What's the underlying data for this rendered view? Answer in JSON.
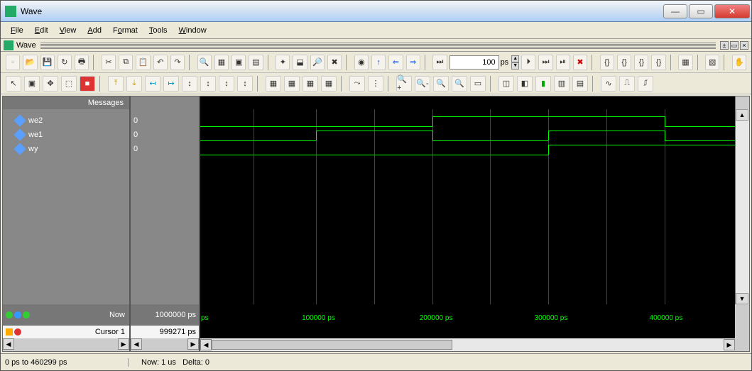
{
  "window": {
    "title": "Wave",
    "panel_title": "Wave"
  },
  "menu": {
    "file": "File",
    "edit": "Edit",
    "view": "View",
    "add": "Add",
    "format": "Format",
    "tools": "Tools",
    "window": "Window"
  },
  "toolbar": {
    "time_value": "100",
    "time_unit": "ps"
  },
  "header": {
    "messages": "Messages"
  },
  "signals": [
    {
      "name": "we2",
      "value": "0"
    },
    {
      "name": "we1",
      "value": "0"
    },
    {
      "name": "wy",
      "value": "0"
    }
  ],
  "chart_data": {
    "type": "timing-diagram",
    "x_unit": "ps",
    "visible_range": [
      0,
      460299
    ],
    "ticks": [
      "ps",
      "100000 ps",
      "200000 ps",
      "300000 ps",
      "400000 ps"
    ],
    "signals": {
      "we2": {
        "initial": 0,
        "edges": [
          {
            "t": 200000,
            "v": 1
          },
          {
            "t": 400000,
            "v": 0
          }
        ]
      },
      "we1": {
        "initial": 0,
        "edges": [
          {
            "t": 100000,
            "v": 1
          },
          {
            "t": 200000,
            "v": 0
          },
          {
            "t": 300000,
            "v": 1
          },
          {
            "t": 400000,
            "v": 0
          }
        ]
      },
      "wy": {
        "initial": 0,
        "edges": [
          {
            "t": 300000,
            "v": 1
          }
        ]
      }
    }
  },
  "time": {
    "now_label": "Now",
    "now_value": "1000000 ps",
    "cursor_label": "Cursor 1",
    "cursor_value": "999271 ps"
  },
  "status": {
    "range": "0 ps to 460299 ps",
    "now": "Now: 1 us",
    "delta": "Delta: 0"
  }
}
